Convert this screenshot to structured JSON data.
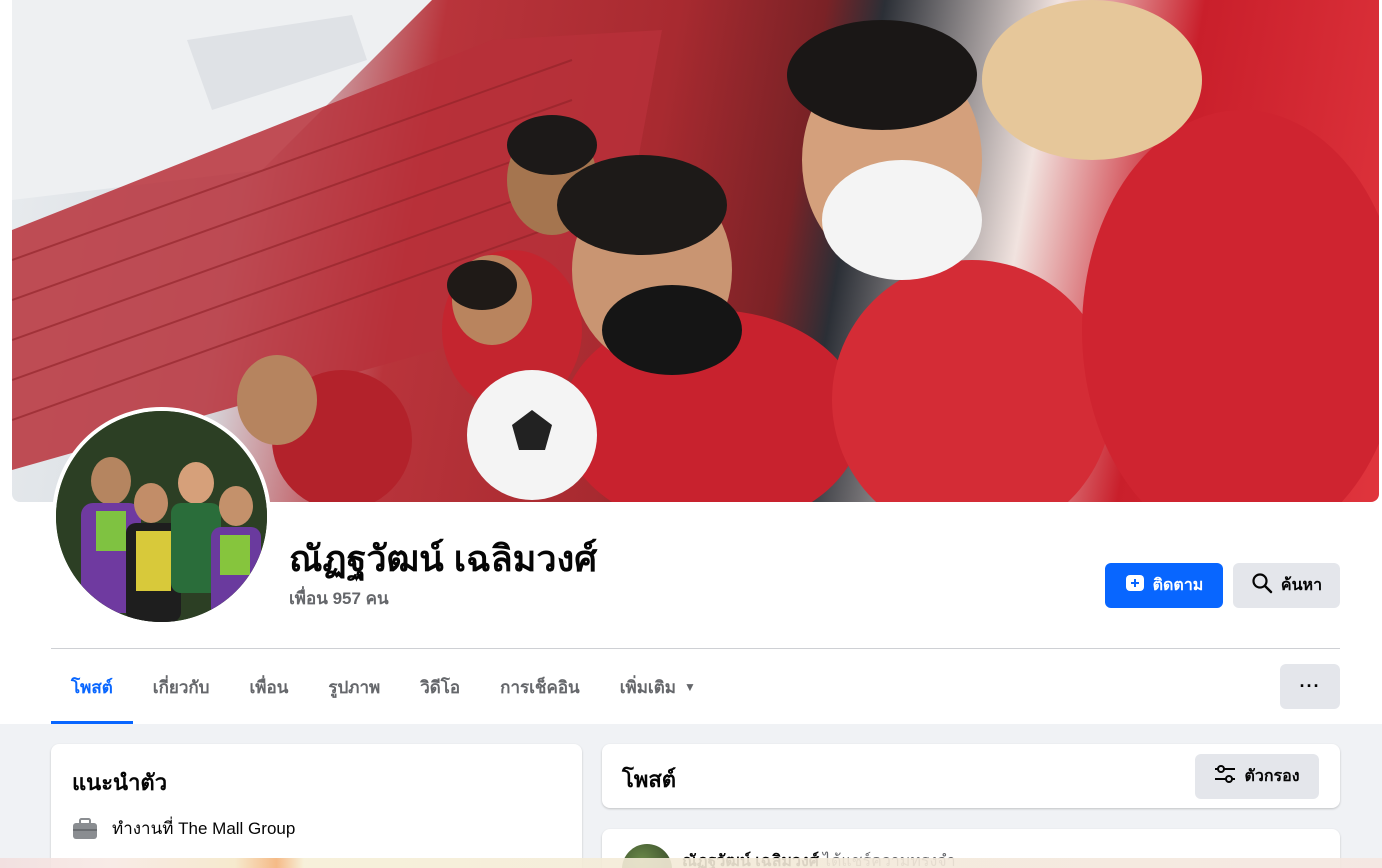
{
  "profile": {
    "name": "ณัฏฐวัฒน์ เฉลิมวงศ์",
    "friends": "เพื่อน 957 คน"
  },
  "actions": {
    "follow_label": "ติดตาม",
    "search_label": "ค้นหา",
    "more_label": "···"
  },
  "tabs": [
    {
      "label": "โพสต์",
      "active": true
    },
    {
      "label": "เกี่ยวกับ"
    },
    {
      "label": "เพื่อน"
    },
    {
      "label": "รูปภาพ"
    },
    {
      "label": "วิดีโอ"
    },
    {
      "label": "การเช็คอิน"
    },
    {
      "label": "เพิ่มเติม"
    }
  ],
  "intro": {
    "title": "แนะนำตัว",
    "work": "ทำงานที่ The Mall Group"
  },
  "posts": {
    "title": "โพสต์",
    "filter_label": "ตัวกรอง",
    "first_post_author": "ณัฏฐวัฒน์ เฉลิมวงศ์",
    "first_post_action": "ได้แชร์ความทรงจำ"
  },
  "colors": {
    "accent": "#0866ff",
    "secondary_button": "#e4e6eb",
    "page_bg": "#f0f2f5"
  },
  "icons": {
    "follow": "person-add-icon",
    "search": "search-icon",
    "filter": "filter-icon",
    "work": "briefcase-icon",
    "caret": "caret-down-icon"
  }
}
